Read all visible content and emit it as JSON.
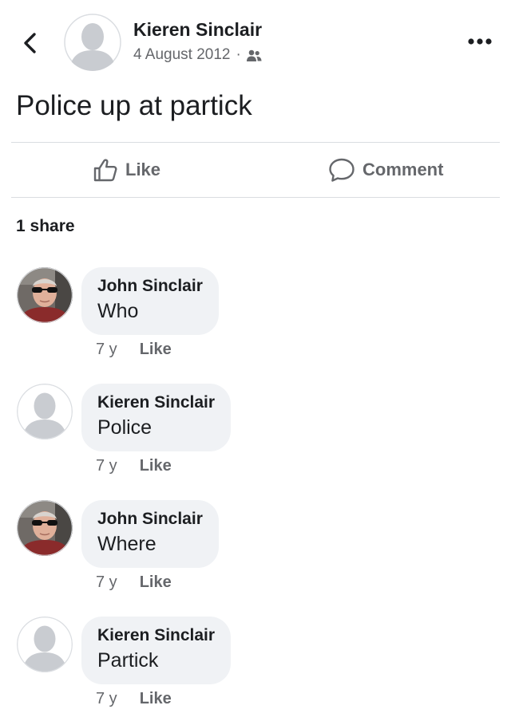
{
  "post": {
    "author": "Kieren Sinclair",
    "date": "4 August 2012",
    "separator": "·",
    "audience_icon": "friends-icon",
    "text": "Police up at partick"
  },
  "actions": {
    "like_label": "Like",
    "comment_label": "Comment"
  },
  "shares_label": "1 share",
  "comments": [
    {
      "author": "John Sinclair",
      "text": "Who",
      "time": "7 y",
      "like_label": "Like",
      "avatar": "photo-avatar"
    },
    {
      "author": "Kieren Sinclair",
      "text": "Police",
      "time": "7 y",
      "like_label": "Like",
      "avatar": "default-avatar"
    },
    {
      "author": "John Sinclair",
      "text": "Where",
      "time": "7 y",
      "like_label": "Like",
      "avatar": "photo-avatar"
    },
    {
      "author": "Kieren Sinclair",
      "text": "Partick",
      "time": "7 y",
      "like_label": "Like",
      "avatar": "default-avatar"
    }
  ],
  "colors": {
    "text_primary": "#1c1e21",
    "text_secondary": "#65676b",
    "bubble_bg": "#f0f2f5",
    "divider": "#dadde1",
    "placeholder_avatar": "#c9ccd1"
  }
}
